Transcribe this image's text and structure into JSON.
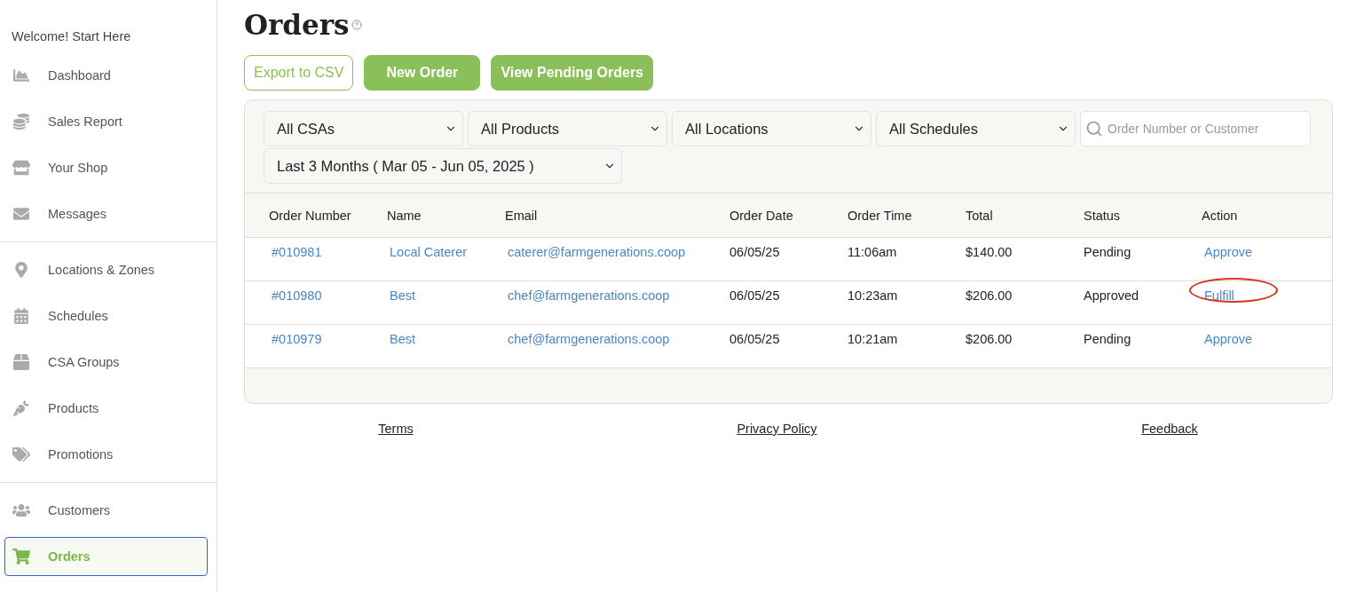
{
  "sidebar": {
    "welcome": "Welcome! Start Here",
    "sections": [
      {
        "items": [
          {
            "label": "Dashboard",
            "selected": false
          },
          {
            "label": "Sales Report",
            "selected": false
          },
          {
            "label": "Your Shop",
            "selected": false
          },
          {
            "label": "Messages",
            "selected": false
          }
        ]
      },
      {
        "items": [
          {
            "label": "Locations & Zones",
            "selected": false
          },
          {
            "label": "Schedules",
            "selected": false
          },
          {
            "label": "CSA Groups",
            "selected": false
          },
          {
            "label": "Products",
            "selected": false
          },
          {
            "label": "Promotions",
            "selected": false
          }
        ]
      },
      {
        "items": [
          {
            "label": "Customers",
            "selected": false
          },
          {
            "label": "Orders",
            "selected": true
          }
        ]
      }
    ]
  },
  "page": {
    "title": "Orders"
  },
  "actions": [
    {
      "label": "Export to CSV",
      "kind": "outline"
    },
    {
      "label": "New Order",
      "kind": "solid"
    },
    {
      "label": "View Pending Orders",
      "kind": "solid"
    }
  ],
  "filters": {
    "selects": [
      "All CSAs",
      "All Products",
      "All Locations",
      "All Schedules"
    ],
    "search": {
      "placeholder": "Order Number or Customer"
    },
    "date_range": "Last 3 Months ( Mar 05 - Jun 05, 2025 )"
  },
  "table": {
    "columns": [
      "Order Number",
      "Name",
      "Email",
      "Order Date",
      "Order Time",
      "Total",
      "Status",
      "Action"
    ],
    "rows": [
      {
        "order": "#010981",
        "name": "Local Caterer",
        "email": "caterer@farmgenerations.coop",
        "date": "06/05/25",
        "time": "11:06am",
        "total": "$140.00",
        "status": "Pending",
        "action": "Approve",
        "circled": false
      },
      {
        "order": "#010980",
        "name": "Best",
        "email": "chef@farmgenerations.coop",
        "date": "06/05/25",
        "time": "10:23am",
        "total": "$206.00",
        "status": "Approved",
        "action": "Fulfill",
        "circled": true
      },
      {
        "order": "#010979",
        "name": "Best",
        "email": "chef@farmgenerations.coop",
        "date": "06/05/25",
        "time": "10:21am",
        "total": "$206.00",
        "status": "Pending",
        "action": "Approve",
        "circled": false
      }
    ]
  },
  "footer": {
    "links": [
      "Terms",
      "Privacy Policy",
      "Feedback"
    ]
  }
}
